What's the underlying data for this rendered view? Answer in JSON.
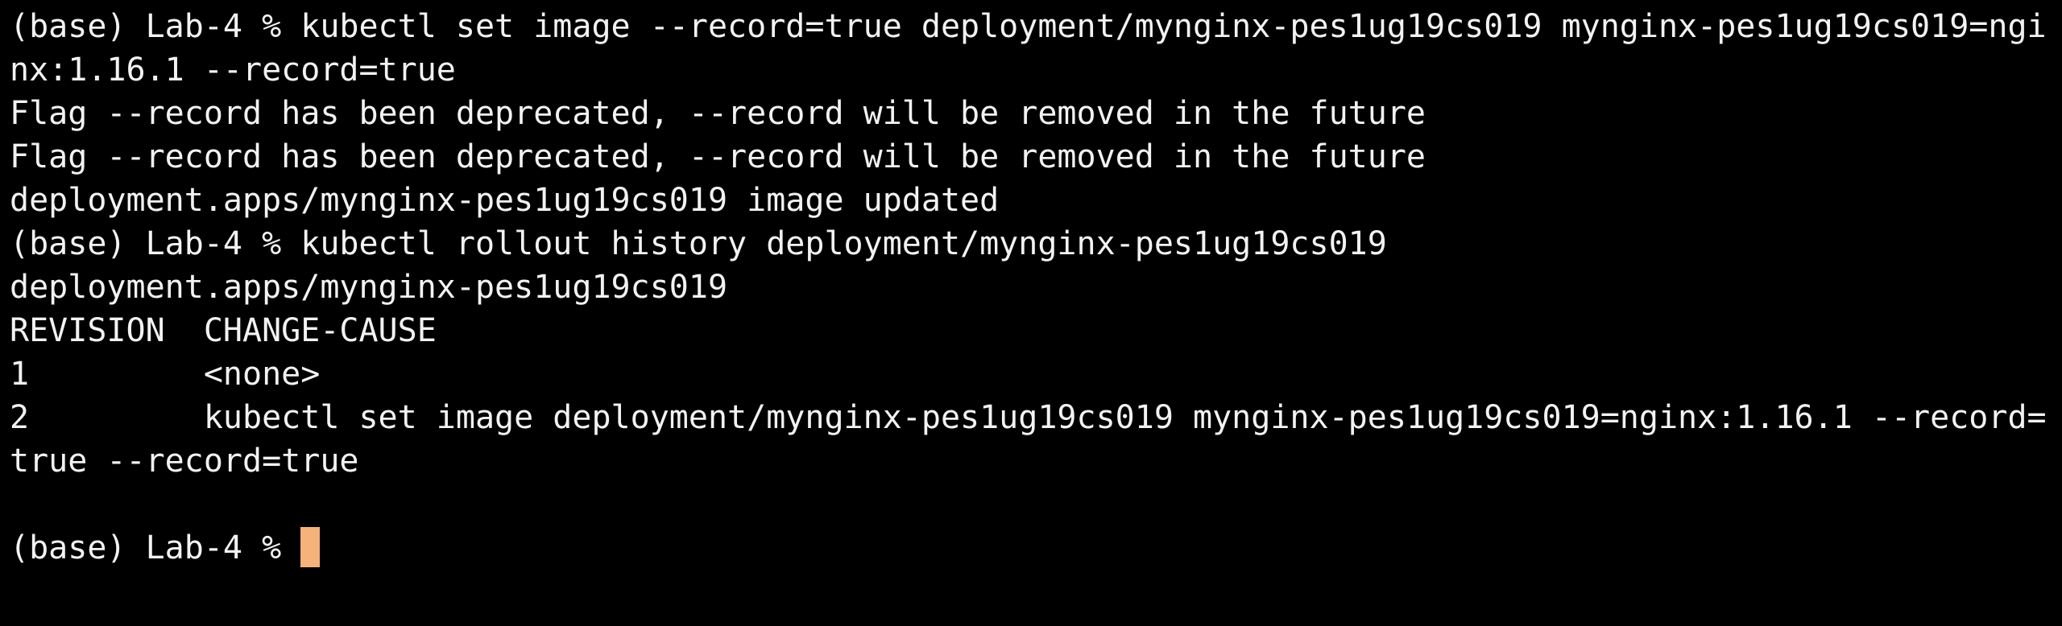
{
  "terminal": {
    "lines": [
      "(base) Lab-4 % kubectl set image --record=true deployment/mynginx-pes1ug19cs019 mynginx-pes1ug19cs019=ngi",
      "nx:1.16.1 --record=true",
      "Flag --record has been deprecated, --record will be removed in the future",
      "Flag --record has been deprecated, --record will be removed in the future",
      "deployment.apps/mynginx-pes1ug19cs019 image updated",
      "(base) Lab-4 % kubectl rollout history deployment/mynginx-pes1ug19cs019",
      "deployment.apps/mynginx-pes1ug19cs019",
      "REVISION  CHANGE-CAUSE",
      "1         <none>",
      "2         kubectl set image deployment/mynginx-pes1ug19cs019 mynginx-pes1ug19cs019=nginx:1.16.1 --record=",
      "true --record=true",
      ""
    ],
    "prompt": "(base) Lab-4 % ",
    "cursor_color": "#f5b27a",
    "background_color": "#000000",
    "text_color": "#f2f2f2"
  }
}
